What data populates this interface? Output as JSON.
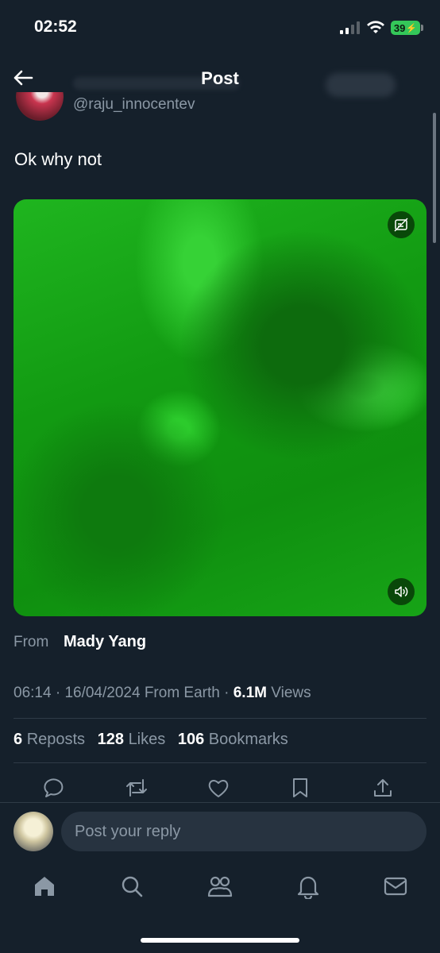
{
  "status_bar": {
    "time": "02:52",
    "battery": "39"
  },
  "header": {
    "title": "Post"
  },
  "author": {
    "handle": "@raju_innocentev"
  },
  "post": {
    "text": "Ok why not",
    "from_label": "From",
    "from_name": "Mady Yang",
    "time": "06:14",
    "date": "16/04/2024",
    "location": "From Earth",
    "views_count": "6.1M",
    "views_label": "Views"
  },
  "stats": {
    "reposts_count": "6",
    "reposts_label": "Reposts",
    "likes_count": "128",
    "likes_label": "Likes",
    "bookmarks_count": "106",
    "bookmarks_label": "Bookmarks"
  },
  "reply": {
    "placeholder": "Post your reply"
  },
  "colors": {
    "background": "#15202b",
    "secondary_text": "#8b98a5",
    "divider": "#2f3b47",
    "battery": "#34c759",
    "media_green": "#129a12"
  },
  "icons": {
    "header": [
      "back-arrow-icon"
    ],
    "media": [
      "alt-caption-icon",
      "sound-icon"
    ],
    "actions": [
      "reply-icon",
      "repost-icon",
      "like-icon",
      "bookmark-icon",
      "share-icon"
    ],
    "tabs": [
      "home-icon",
      "search-icon",
      "communities-icon",
      "notifications-icon",
      "messages-icon"
    ]
  }
}
